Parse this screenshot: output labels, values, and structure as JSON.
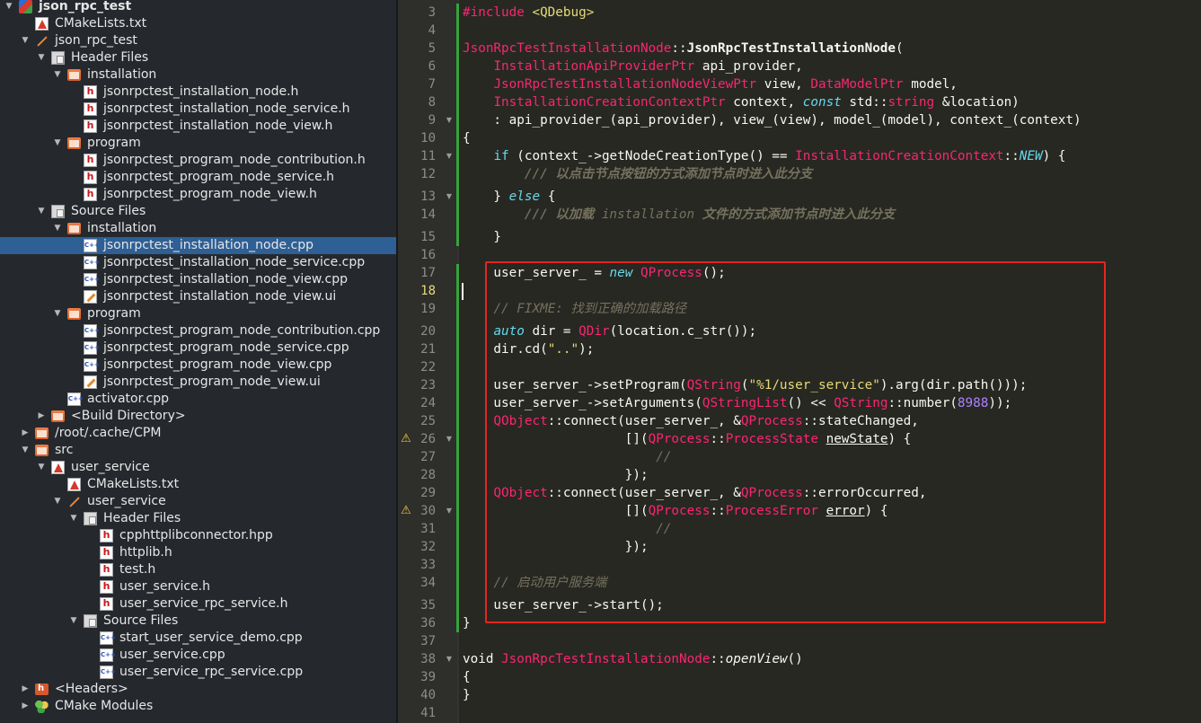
{
  "tree": {
    "project": "json_rpc_test",
    "items": [
      {
        "label": "json_rpc_test",
        "icon": "project-icon",
        "indent": 0,
        "arrow": "expanded",
        "bold": true
      },
      {
        "label": "CMakeLists.txt",
        "icon": "cmake-file-icon",
        "indent": 1,
        "arrow": "none"
      },
      {
        "label": "json_rpc_test",
        "icon": "wand-icon",
        "indent": 1,
        "arrow": "expanded"
      },
      {
        "label": "Header Files",
        "icon": "filter-folder-icon",
        "indent": 2,
        "arrow": "expanded"
      },
      {
        "label": "installation",
        "icon": "folder-icon",
        "indent": 3,
        "arrow": "expanded"
      },
      {
        "label": "jsonrpctest_installation_node.h",
        "icon": "header-file-icon",
        "indent": 4,
        "arrow": "none"
      },
      {
        "label": "jsonrpctest_installation_node_service.h",
        "icon": "header-file-icon",
        "indent": 4,
        "arrow": "none"
      },
      {
        "label": "jsonrpctest_installation_node_view.h",
        "icon": "header-file-icon",
        "indent": 4,
        "arrow": "none"
      },
      {
        "label": "program",
        "icon": "folder-icon",
        "indent": 3,
        "arrow": "expanded"
      },
      {
        "label": "jsonrpctest_program_node_contribution.h",
        "icon": "header-file-icon",
        "indent": 4,
        "arrow": "none"
      },
      {
        "label": "jsonrpctest_program_node_service.h",
        "icon": "header-file-icon",
        "indent": 4,
        "arrow": "none"
      },
      {
        "label": "jsonrpctest_program_node_view.h",
        "icon": "header-file-icon",
        "indent": 4,
        "arrow": "none"
      },
      {
        "label": "Source Files",
        "icon": "filter-folder-icon",
        "indent": 2,
        "arrow": "expanded"
      },
      {
        "label": "installation",
        "icon": "folder-icon",
        "indent": 3,
        "arrow": "expanded"
      },
      {
        "label": "jsonrpctest_installation_node.cpp",
        "icon": "cpp-file-icon",
        "indent": 4,
        "arrow": "none",
        "selected": true
      },
      {
        "label": "jsonrpctest_installation_node_service.cpp",
        "icon": "cpp-file-icon",
        "indent": 4,
        "arrow": "none"
      },
      {
        "label": "jsonrpctest_installation_node_view.cpp",
        "icon": "cpp-file-icon",
        "indent": 4,
        "arrow": "none"
      },
      {
        "label": "jsonrpctest_installation_node_view.ui",
        "icon": "ui-file-icon",
        "indent": 4,
        "arrow": "none"
      },
      {
        "label": "program",
        "icon": "folder-icon",
        "indent": 3,
        "arrow": "expanded"
      },
      {
        "label": "jsonrpctest_program_node_contribution.cpp",
        "icon": "cpp-file-icon",
        "indent": 4,
        "arrow": "none"
      },
      {
        "label": "jsonrpctest_program_node_service.cpp",
        "icon": "cpp-file-icon",
        "indent": 4,
        "arrow": "none"
      },
      {
        "label": "jsonrpctest_program_node_view.cpp",
        "icon": "cpp-file-icon",
        "indent": 4,
        "arrow": "none"
      },
      {
        "label": "jsonrpctest_program_node_view.ui",
        "icon": "ui-file-icon",
        "indent": 4,
        "arrow": "none"
      },
      {
        "label": "activator.cpp",
        "icon": "cpp-file-icon",
        "indent": 3,
        "arrow": "none"
      },
      {
        "label": "<Build Directory>",
        "icon": "build-directory-icon",
        "indent": 2,
        "arrow": "collapsed"
      },
      {
        "label": "/root/.cache/CPM",
        "icon": "folder-icon",
        "indent": 1,
        "arrow": "collapsed"
      },
      {
        "label": "src",
        "icon": "folder-icon",
        "indent": 1,
        "arrow": "expanded"
      },
      {
        "label": "user_service",
        "icon": "cmake-project-icon",
        "indent": 2,
        "arrow": "expanded"
      },
      {
        "label": "CMakeLists.txt",
        "icon": "cmake-file-icon",
        "indent": 3,
        "arrow": "none"
      },
      {
        "label": "user_service",
        "icon": "wand-icon",
        "indent": 3,
        "arrow": "expanded"
      },
      {
        "label": "Header Files",
        "icon": "filter-folder-icon",
        "indent": 4,
        "arrow": "expanded"
      },
      {
        "label": "cpphttplibconnector.hpp",
        "icon": "header-file-icon",
        "indent": 5,
        "arrow": "none"
      },
      {
        "label": "httplib.h",
        "icon": "header-file-icon",
        "indent": 5,
        "arrow": "none"
      },
      {
        "label": "test.h",
        "icon": "header-file-icon",
        "indent": 5,
        "arrow": "none"
      },
      {
        "label": "user_service.h",
        "icon": "header-file-icon",
        "indent": 5,
        "arrow": "none"
      },
      {
        "label": "user_service_rpc_service.h",
        "icon": "header-file-icon",
        "indent": 5,
        "arrow": "none"
      },
      {
        "label": "Source Files",
        "icon": "filter-folder-icon",
        "indent": 4,
        "arrow": "expanded"
      },
      {
        "label": "start_user_service_demo.cpp",
        "icon": "cpp-file-icon",
        "indent": 5,
        "arrow": "none"
      },
      {
        "label": "user_service.cpp",
        "icon": "cpp-file-icon",
        "indent": 5,
        "arrow": "none"
      },
      {
        "label": "user_service_rpc_service.cpp",
        "icon": "cpp-file-icon",
        "indent": 5,
        "arrow": "none"
      },
      {
        "label": "<Headers>",
        "icon": "headers-folder-icon",
        "indent": 1,
        "arrow": "collapsed"
      },
      {
        "label": "CMake Modules",
        "icon": "cmake-modules-icon",
        "indent": 1,
        "arrow": "collapsed"
      }
    ]
  },
  "editor": {
    "current_line": 18,
    "lines": [
      {
        "n": 3,
        "fold": false,
        "warn": false,
        "tokens": [
          [
            "pp",
            "#include "
          ],
          [
            "inc",
            "<QDebug>"
          ]
        ]
      },
      {
        "n": 4,
        "tokens": []
      },
      {
        "n": 5,
        "tokens": [
          [
            "ty",
            "JsonRpcTestInstallationNode"
          ],
          [
            "ws",
            "::"
          ],
          [
            "fn",
            "JsonRpcTestInstallationNode"
          ],
          [
            "ws",
            "("
          ]
        ]
      },
      {
        "n": 6,
        "tokens": [
          [
            "ws",
            "    "
          ],
          [
            "ty",
            "InstallationApiProviderPtr"
          ],
          [
            "ws",
            " api_provider,"
          ]
        ]
      },
      {
        "n": 7,
        "tokens": [
          [
            "ws",
            "    "
          ],
          [
            "ty",
            "JsonRpcTestInstallationNodeViewPtr"
          ],
          [
            "ws",
            " view, "
          ],
          [
            "ty",
            "DataModelPtr"
          ],
          [
            "ws",
            " model,"
          ]
        ]
      },
      {
        "n": 8,
        "tokens": [
          [
            "ws",
            "    "
          ],
          [
            "ty",
            "InstallationCreationContextPtr"
          ],
          [
            "ws",
            " context, "
          ],
          [
            "kw",
            "const"
          ],
          [
            "ws",
            " std::"
          ],
          [
            "ty",
            "string"
          ],
          [
            "ws",
            " &location)"
          ]
        ]
      },
      {
        "n": 9,
        "fold": true,
        "tokens": [
          [
            "ws",
            "    : api_provider_(api_provider), view_(view), model_(model), context_(context)"
          ]
        ]
      },
      {
        "n": 10,
        "tokens": [
          [
            "ws",
            "{"
          ]
        ]
      },
      {
        "n": 11,
        "fold": true,
        "tokens": [
          [
            "ws",
            "    "
          ],
          [
            "kw2",
            "if"
          ],
          [
            "ws",
            " (context_->getNodeCreationType() == "
          ],
          [
            "ty",
            "InstallationCreationContext"
          ],
          [
            "ws",
            "::"
          ],
          [
            "en",
            "NEW"
          ],
          [
            "ws",
            ") {"
          ]
        ]
      },
      {
        "n": 12,
        "tokens": [
          [
            "ws",
            "        "
          ],
          [
            "dc",
            "/// 以点击节点按钮的方式添加节点时进入此分支"
          ]
        ]
      },
      {
        "n": 13,
        "fold": true,
        "tokens": [
          [
            "ws",
            "    } "
          ],
          [
            "kw",
            "else"
          ],
          [
            "ws",
            " {"
          ]
        ]
      },
      {
        "n": 14,
        "tokens": [
          [
            "ws",
            "        "
          ],
          [
            "dc",
            "/// 以加载 "
          ],
          [
            "cm",
            "installation"
          ],
          [
            "dc",
            " 文件的方式添加节点时进入此分支"
          ]
        ]
      },
      {
        "n": 15,
        "tokens": [
          [
            "ws",
            "    }"
          ]
        ]
      },
      {
        "n": 16,
        "tokens": []
      },
      {
        "n": 17,
        "tokens": [
          [
            "ws",
            "    user_server_ = "
          ],
          [
            "kw",
            "new"
          ],
          [
            "ws",
            " "
          ],
          [
            "ty",
            "QProcess"
          ],
          [
            "ws",
            "();"
          ]
        ]
      },
      {
        "n": 18,
        "tokens": []
      },
      {
        "n": 19,
        "tokens": [
          [
            "ws",
            "    "
          ],
          [
            "cm",
            "// FIXME: 找到正确的加载路径"
          ]
        ]
      },
      {
        "n": 20,
        "tokens": [
          [
            "ws",
            "    "
          ],
          [
            "kw",
            "auto"
          ],
          [
            "ws",
            " dir = "
          ],
          [
            "ty",
            "QDir"
          ],
          [
            "ws",
            "(location.c_str());"
          ]
        ]
      },
      {
        "n": 21,
        "tokens": [
          [
            "ws",
            "    dir.cd("
          ],
          [
            "str",
            "\"..\""
          ],
          [
            "ws",
            ");"
          ]
        ]
      },
      {
        "n": 22,
        "tokens": []
      },
      {
        "n": 23,
        "tokens": [
          [
            "ws",
            "    user_server_->setProgram("
          ],
          [
            "ty",
            "QString"
          ],
          [
            "ws",
            "("
          ],
          [
            "str",
            "\"%1/user_service\""
          ],
          [
            "ws",
            ").arg(dir.path()));"
          ]
        ]
      },
      {
        "n": 24,
        "tokens": [
          [
            "ws",
            "    user_server_->setArguments("
          ],
          [
            "ty",
            "QStringList"
          ],
          [
            "ws",
            "() << "
          ],
          [
            "ty",
            "QString"
          ],
          [
            "ws",
            "::number("
          ],
          [
            "num",
            "8988"
          ],
          [
            "ws",
            "));"
          ]
        ]
      },
      {
        "n": 25,
        "tokens": [
          [
            "ty",
            "    QObject"
          ],
          [
            "ws",
            "::connect(user_server_, &"
          ],
          [
            "ty",
            "QProcess"
          ],
          [
            "ws",
            "::stateChanged,"
          ]
        ]
      },
      {
        "n": 26,
        "fold": true,
        "warn": true,
        "tokens": [
          [
            "ws",
            "                     []("
          ],
          [
            "ty",
            "QProcess"
          ],
          [
            "ws",
            "::"
          ],
          [
            "ty",
            "ProcessState"
          ],
          [
            "ws",
            " "
          ],
          [
            "ul",
            "newState"
          ],
          [
            "ws",
            ") {"
          ]
        ]
      },
      {
        "n": 27,
        "tokens": [
          [
            "ws",
            "                         "
          ],
          [
            "cm",
            "//"
          ]
        ]
      },
      {
        "n": 28,
        "tokens": [
          [
            "ws",
            "                     });"
          ]
        ]
      },
      {
        "n": 29,
        "tokens": [
          [
            "ty",
            "    QObject"
          ],
          [
            "ws",
            "::connect(user_server_, &"
          ],
          [
            "ty",
            "QProcess"
          ],
          [
            "ws",
            "::errorOccurred,"
          ]
        ]
      },
      {
        "n": 30,
        "fold": true,
        "warn": true,
        "tokens": [
          [
            "ws",
            "                     []("
          ],
          [
            "ty",
            "QProcess"
          ],
          [
            "ws",
            "::"
          ],
          [
            "ty",
            "ProcessError"
          ],
          [
            "ws",
            " "
          ],
          [
            "ul",
            "error"
          ],
          [
            "ws",
            ") {"
          ]
        ]
      },
      {
        "n": 31,
        "tokens": [
          [
            "ws",
            "                         "
          ],
          [
            "cm",
            "//"
          ]
        ]
      },
      {
        "n": 32,
        "tokens": [
          [
            "ws",
            "                     });"
          ]
        ]
      },
      {
        "n": 33,
        "tokens": []
      },
      {
        "n": 34,
        "tokens": [
          [
            "ws",
            "    "
          ],
          [
            "cm",
            "// 启动用户服务端"
          ]
        ]
      },
      {
        "n": 35,
        "tokens": [
          [
            "ws",
            "    user_server_->start();"
          ]
        ]
      },
      {
        "n": 36,
        "tokens": [
          [
            "ws",
            "}"
          ]
        ]
      },
      {
        "n": 37,
        "tokens": []
      },
      {
        "n": 38,
        "fold": true,
        "tokens": [
          [
            "ws",
            "void "
          ],
          [
            "ty",
            "JsonRpcTestInstallationNode"
          ],
          [
            "ws",
            "::"
          ],
          [
            "it",
            "openView"
          ],
          [
            "ws",
            "()"
          ]
        ]
      },
      {
        "n": 39,
        "tokens": [
          [
            "ws",
            "{"
          ]
        ]
      },
      {
        "n": 40,
        "tokens": [
          [
            "ws",
            "}"
          ]
        ]
      },
      {
        "n": 41,
        "tokens": []
      }
    ]
  }
}
